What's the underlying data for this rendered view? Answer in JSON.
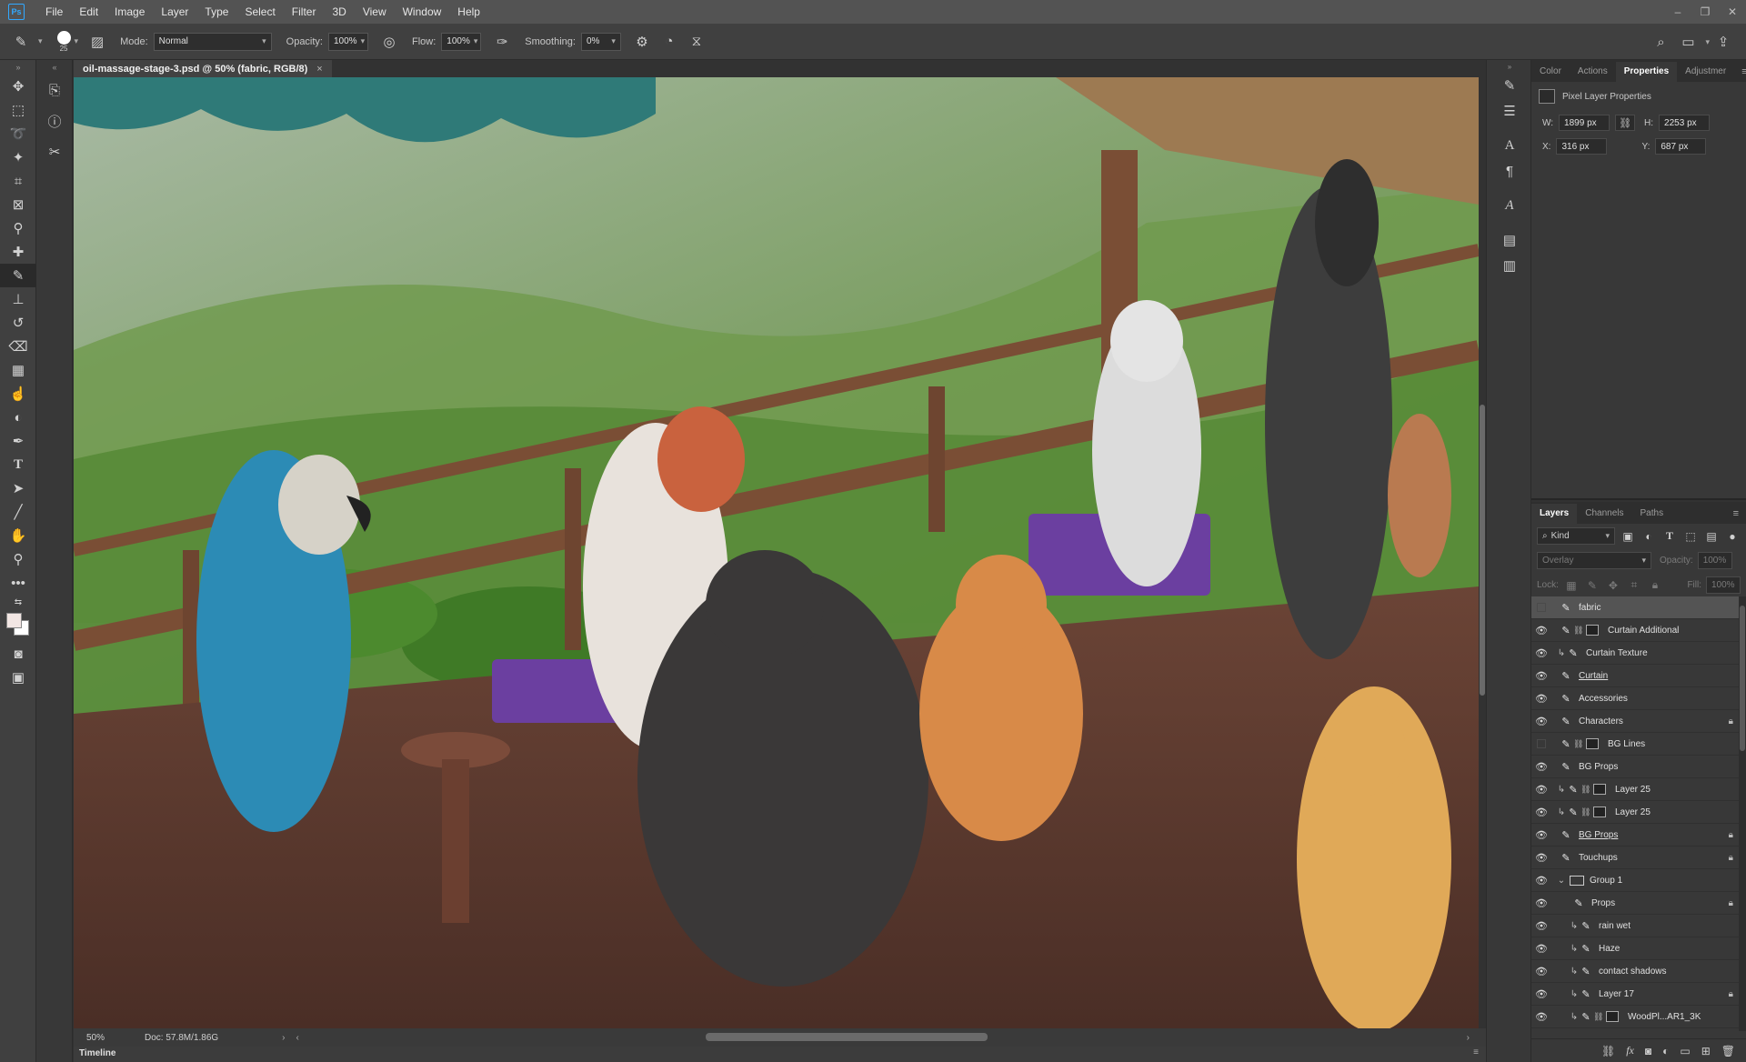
{
  "menu": [
    "File",
    "Edit",
    "Image",
    "Layer",
    "Type",
    "Select",
    "Filter",
    "3D",
    "View",
    "Window",
    "Help"
  ],
  "window_controls": {
    "minimize": "–",
    "restore": "❐",
    "close": "✕"
  },
  "options": {
    "brush_size": "25",
    "mode_label": "Mode:",
    "mode_value": "Normal",
    "opacity_label": "Opacity:",
    "opacity_value": "100%",
    "flow_label": "Flow:",
    "flow_value": "100%",
    "smoothing_label": "Smoothing:",
    "smoothing_value": "0%"
  },
  "document": {
    "tab_title": "oil-massage-stage-3.psd @ 50% (fabric, RGB/8)",
    "close": "×",
    "zoom": "50%",
    "doc_size": "Doc: 57.8M/1.86G"
  },
  "timeline_label": "Timeline",
  "properties_panel": {
    "tabs": [
      "Color",
      "Actions",
      "Properties",
      "Adjustmer"
    ],
    "active_tab": "Properties",
    "title": "Pixel Layer Properties",
    "w_label": "W:",
    "w_value": "1899 px",
    "h_label": "H:",
    "h_value": "2253 px",
    "x_label": "X:",
    "x_value": "316 px",
    "y_label": "Y:",
    "y_value": "687 px"
  },
  "layers_panel": {
    "tabs": [
      "Layers",
      "Channels",
      "Paths"
    ],
    "active_tab": "Layers",
    "filter_kind": "Kind",
    "blend_mode": "Overlay",
    "opacity_label": "Opacity:",
    "opacity_value": "100%",
    "lock_label": "Lock:",
    "fill_label": "Fill:",
    "fill_value": "100%",
    "layers": [
      {
        "name": "fabric",
        "visible": false,
        "selected": true
      },
      {
        "name": "Curtain Additional",
        "visible": true,
        "mask": true
      },
      {
        "name": "Curtain Texture",
        "visible": true,
        "clipped": true
      },
      {
        "name": "Curtain",
        "visible": true,
        "underline": true
      },
      {
        "name": "Accessories",
        "visible": true
      },
      {
        "name": "Characters",
        "visible": true,
        "locked": true
      },
      {
        "name": "BG Lines",
        "visible": false,
        "mask": true
      },
      {
        "name": "BG Props",
        "visible": true
      },
      {
        "name": "Layer 25",
        "visible": true,
        "clipped": true,
        "mask": true
      },
      {
        "name": "Layer 25",
        "visible": true,
        "clipped": true,
        "mask": true
      },
      {
        "name": "BG Props",
        "visible": true,
        "underline": true,
        "locked": true
      },
      {
        "name": "Touchups",
        "visible": true,
        "locked": true
      },
      {
        "name": "Group 1",
        "visible": true,
        "group": true
      },
      {
        "name": "Props",
        "visible": true,
        "indent": true,
        "locked": true
      },
      {
        "name": "rain wet",
        "visible": true,
        "indent": true,
        "clipped": true
      },
      {
        "name": "Haze",
        "visible": true,
        "indent": true,
        "clipped": true
      },
      {
        "name": "contact shadows",
        "visible": true,
        "indent": true,
        "clipped": true
      },
      {
        "name": "Layer 17",
        "visible": true,
        "indent": true,
        "clipped": true,
        "locked": true
      },
      {
        "name": "WoodPl...AR1_3K",
        "visible": true,
        "indent": true,
        "clipped": true,
        "mask": true
      }
    ]
  },
  "icons": {
    "eye": "eye-icon",
    "lock": "lock-icon",
    "brush": "brush-icon"
  }
}
